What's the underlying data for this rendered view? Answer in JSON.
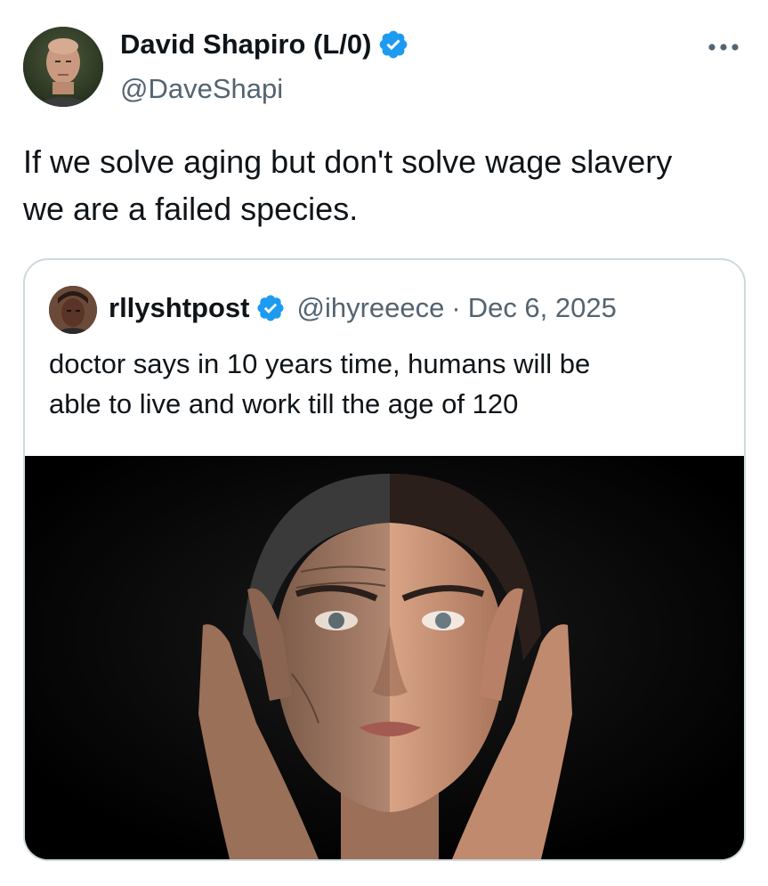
{
  "tweet": {
    "author": {
      "name": "David Shapiro (L/0)",
      "handle": "@DaveShapi",
      "verified": true,
      "avatar_icon": "profile-photo-bald-man"
    },
    "more_icon": "more-options-icon",
    "text": "If we solve aging but don't solve wage slavery\nwe are a failed species."
  },
  "quoted": {
    "author": {
      "name": "rllyshtpost",
      "handle": "@ihyreeece",
      "verified": true,
      "avatar_icon": "profile-photo"
    },
    "separator": "·",
    "date": "Dec 6, 2025",
    "text": "doctor says in 10 years time, humans will be\nable to live and work till the age of 120",
    "image_icon": "photo-aging-face-half-old-half-young"
  },
  "colors": {
    "verified_blue": "#1d9bf0",
    "secondary_text": "#536471",
    "border": "#cfd9de",
    "text": "#0f1419"
  }
}
